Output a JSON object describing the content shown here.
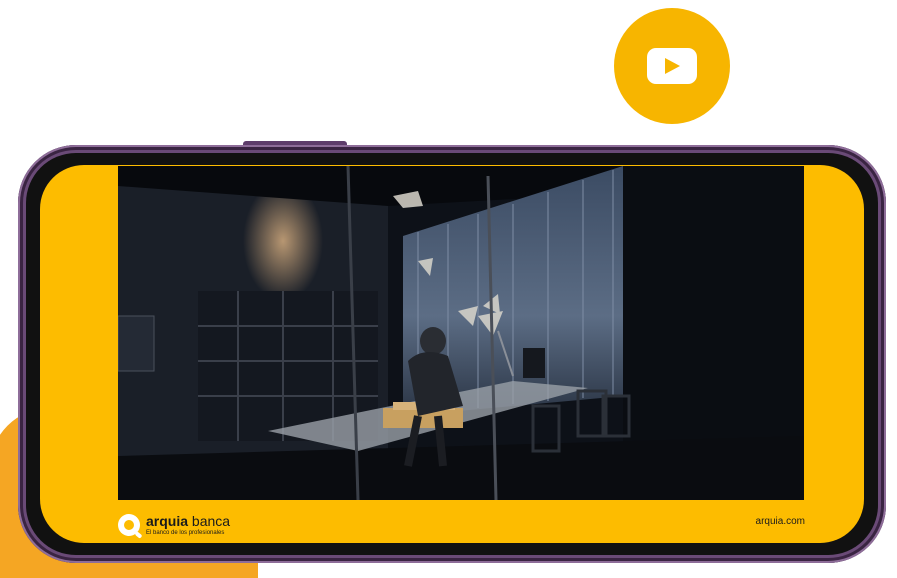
{
  "colors": {
    "accent_yellow": "#fdbc00",
    "accent_orange": "#f5a623",
    "phone_frame": "#6a4a77",
    "play_badge": "#f7b500"
  },
  "icons": {
    "play_badge": "play-icon",
    "brand_logo": "arquia-q-logo"
  },
  "brand": {
    "name_bold": "arquia",
    "name_light": " banca",
    "tagline": "El banco de los profesionales"
  },
  "footer": {
    "url": "arquia.com"
  }
}
